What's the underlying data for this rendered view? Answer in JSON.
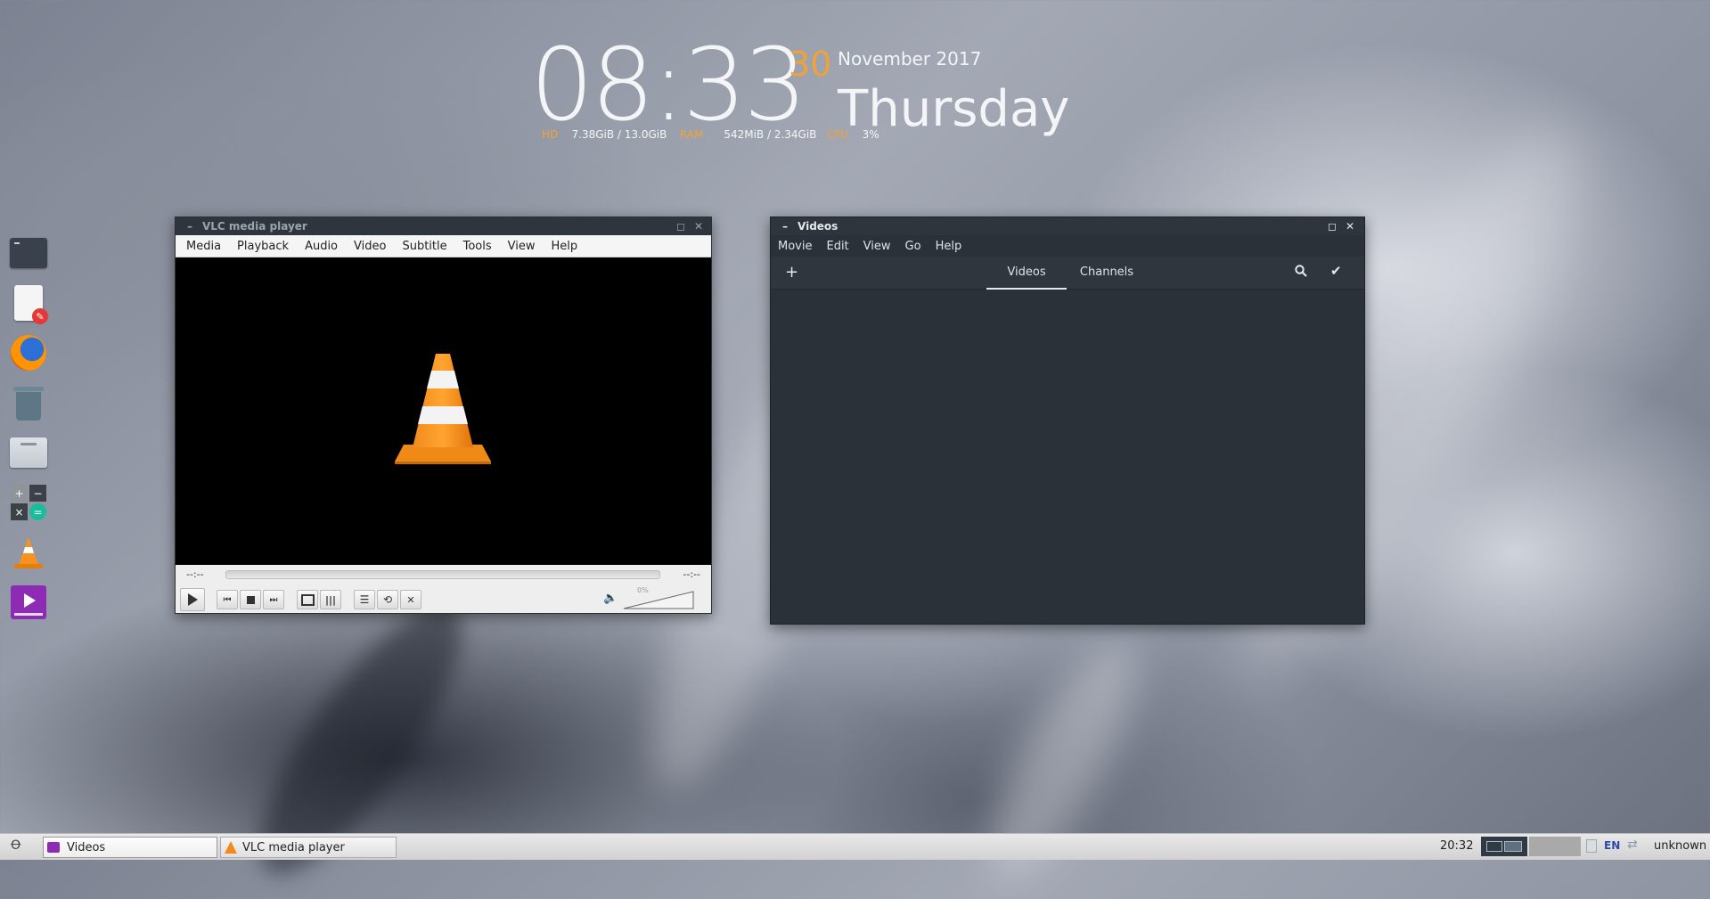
{
  "conky": {
    "time": "08:33",
    "day_number": "30",
    "month_year": "November 2017",
    "weekday": "Thursday",
    "hd_label": "HD",
    "hd_value": "7.38GiB / 13.0GiB",
    "ram_label": "RAM",
    "ram_value": "542MiB / 2.34GiB",
    "cpu_label": "CPU",
    "cpu_value": "3%"
  },
  "dock": {
    "items": [
      "terminal-icon",
      "text-editor-icon",
      "firefox-icon",
      "trash-icon",
      "file-manager-icon",
      "calculator-icon",
      "vlc-icon",
      "videos-icon"
    ]
  },
  "vlc": {
    "title": "VLC media player",
    "menu": [
      "Media",
      "Playback",
      "Audio",
      "Video",
      "Subtitle",
      "Tools",
      "View",
      "Help"
    ],
    "time_elapsed": "--:--",
    "time_total": "--:--",
    "volume_label": "0%",
    "volume_level": 0
  },
  "videos": {
    "title": "Videos",
    "menu": [
      "Movie",
      "Edit",
      "View",
      "Go",
      "Help"
    ],
    "tabs": [
      "Videos",
      "Channels"
    ],
    "active_tab": "Videos"
  },
  "taskbar": {
    "tasks": [
      "Videos",
      "VLC media player"
    ],
    "clock": "20:32",
    "language": "EN",
    "user": "unknown"
  },
  "colors": {
    "accent_orange": "#f0a23a",
    "dark_panel": "#2b3139"
  }
}
